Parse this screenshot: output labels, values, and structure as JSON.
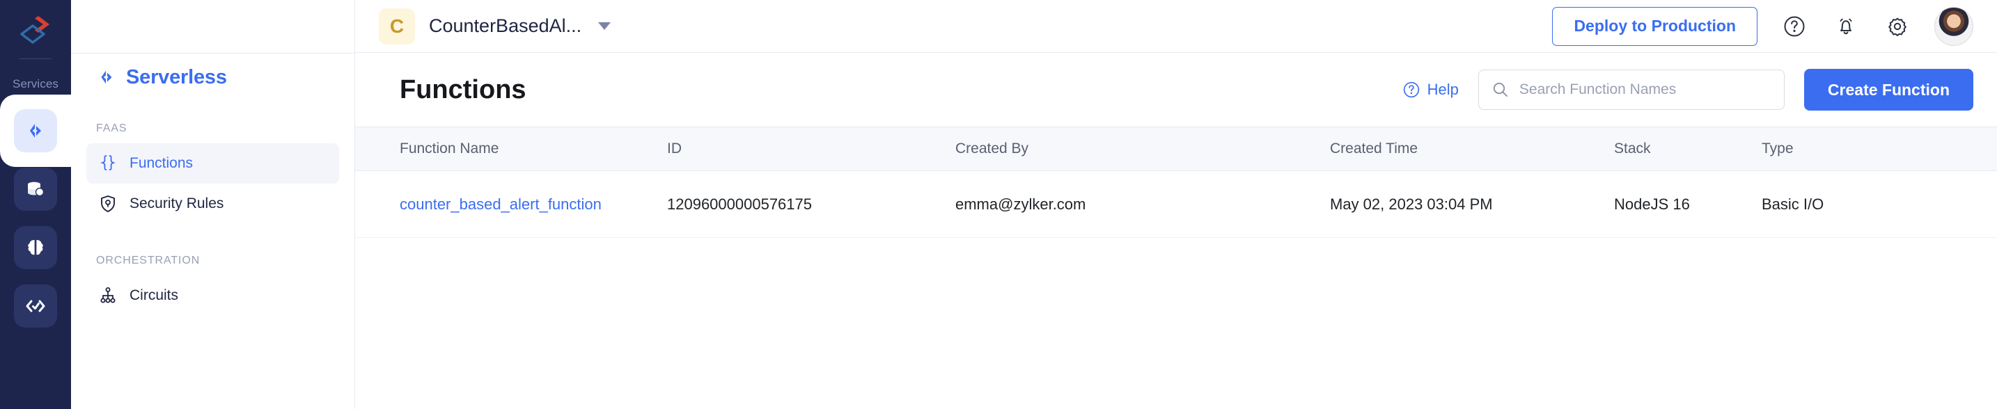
{
  "rail": {
    "logo_name": "zoho-catalyst-logo",
    "services_label": "Services",
    "items": [
      {
        "name": "serverless",
        "icon": "code-chevrons-icon",
        "active": true
      },
      {
        "name": "data-store",
        "icon": "database-icon",
        "active": false
      },
      {
        "name": "ai",
        "icon": "brain-icon",
        "active": false
      },
      {
        "name": "devops",
        "icon": "code-check-icon",
        "active": false
      }
    ]
  },
  "sidebar": {
    "title": "Serverless",
    "title_icon": "code-chevrons-icon",
    "groups": [
      {
        "label": "FAAS",
        "items": [
          {
            "label": "Functions",
            "icon": "curly-braces-icon",
            "active": true
          },
          {
            "label": "Security Rules",
            "icon": "shield-lock-icon",
            "active": false
          }
        ]
      },
      {
        "label": "ORCHESTRATION",
        "items": [
          {
            "label": "Circuits",
            "icon": "hierarchy-icon",
            "active": false
          }
        ]
      }
    ]
  },
  "topbar": {
    "project": {
      "initial": "C",
      "name": "CounterBasedAl..."
    },
    "deploy_label": "Deploy to Production",
    "icons": [
      "help-circle-icon",
      "bell-icon",
      "gear-icon"
    ],
    "avatar_name": "user-avatar"
  },
  "content": {
    "title": "Functions",
    "help_label": "Help",
    "search_placeholder": "Search Function Names",
    "search_value": "",
    "create_label": "Create Function"
  },
  "table": {
    "columns": [
      "Function Name",
      "ID",
      "Created By",
      "Created Time",
      "Stack",
      "Type"
    ],
    "rows": [
      {
        "function_name": "counter_based_alert_function",
        "id": "12096000000576175",
        "created_by": "emma@zylker.com",
        "created_time": "May 02, 2023 03:04 PM",
        "stack": "NodeJS 16",
        "type": "Basic I/O"
      }
    ]
  },
  "colors": {
    "accent": "#3a6df0",
    "rail_bg": "#1e254d",
    "header_bg": "#f7f8fb"
  }
}
